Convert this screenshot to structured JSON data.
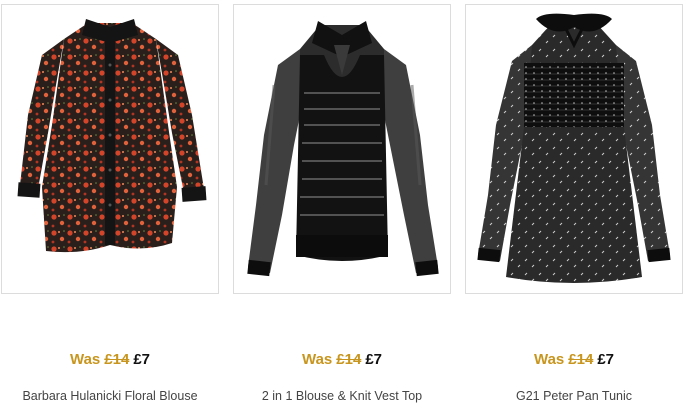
{
  "products": [
    {
      "name": "Barbara Hulanicki Floral Blouse",
      "was_label": "Was",
      "was_price": "£14",
      "now_price": "£7",
      "image_icon": "floral-blouse-image"
    },
    {
      "name": "2 in 1 Blouse & Knit Vest Top",
      "was_label": "Was",
      "was_price": "£14",
      "now_price": "£7",
      "image_icon": "blouse-knit-vest-image"
    },
    {
      "name": "G21 Peter Pan Tunic",
      "was_label": "Was",
      "was_price": "£14",
      "now_price": "£7",
      "image_icon": "peter-pan-tunic-image"
    }
  ],
  "colors": {
    "was_price": "#c8961e",
    "now_price": "#111111",
    "name_text": "#444444",
    "card_border": "#dcdcdc"
  }
}
